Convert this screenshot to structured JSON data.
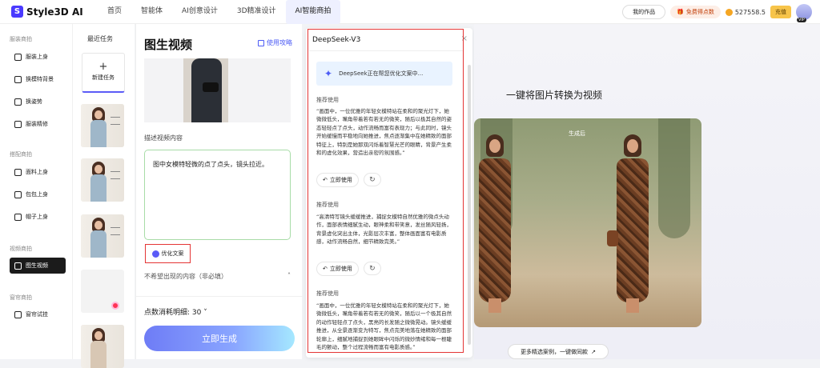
{
  "header": {
    "logo_mark": "S",
    "logo_text": "Style3D AI",
    "nav": [
      "首页",
      "智能体",
      "AI创意设计",
      "3D精准设计",
      "AI智能商拍"
    ],
    "active_nav_index": 4,
    "my_works": "我的作品",
    "free_points": "免费得点数",
    "balance": "527558.5",
    "topup": "充值",
    "vip": "VIP"
  },
  "sidebar": {
    "sections": [
      {
        "title": "服装商拍",
        "items": [
          "服装上身",
          "换模特背景",
          "换姿势",
          "服装精修"
        ]
      },
      {
        "title": "搭配商拍",
        "items": [
          "面料上身",
          "包包上身",
          "帽子上身"
        ]
      },
      {
        "title": "视频商拍",
        "items": [
          "图生视频"
        ]
      },
      {
        "title": "窗帘商拍",
        "items": [
          "窗帘试挂"
        ]
      }
    ],
    "active_item": "图生视频"
  },
  "tasks": {
    "title": "最近任务",
    "new_task": "新建任务"
  },
  "form": {
    "title": "图生视频",
    "guide": "使用攻略",
    "desc_label": "描述视频内容",
    "desc_value": "图中女模特轻微的点了点头，镜头拉近。",
    "optimize": "优化文案",
    "negative_label": "不希望出现的内容（非必填）",
    "cost": "点数消耗明细: 30",
    "generate": "立即生成"
  },
  "panel": {
    "title": "DeepSeek-V3",
    "thinking": "DeepSeek正在帮您优化文案中...",
    "rec_label": "推荐使用",
    "use_label": "立即使用",
    "recommendations": [
      "“画面中，一位优雅的年轻女模特站在柔和的聚光灯下，她微微低头，嘴角带着若有若无的微笑，随后以极其自然的姿态轻轻点了点头，动作流畅而富有表现力；与此同时，镜头开始缓慢而平稳地向她推进，焦点逐渐集中在她精致的面部特征上，特别是她那双闪烁着智慧光芒的眼睛，背景产生柔和的虚化效果，营造出亲密的氛围感。”",
      "“高清特写镜头缓缓推进，捕捉女模特自然优雅的微点头动作，面部表情细腻生动，眼神柔和带笑意，发丝随风轻扬，背景虚化突出主体，光影层次丰富，整体画面富有电影质感，动作流畅自然，细节精致完美。”",
      "“画面中，一位优雅的年轻女模特站在柔和的聚光灯下，她微微低头，嘴角带着若有若无的微笑，随后以一个极其自然的动作轻轻点了点头，黑亮的长发随之微微晃动。镜头缓缓推进，从全景逐渐变为特写，焦点完美地落在她精致的面部轮廓上，细腻地捕捉到她眼眸中闪烁的微妙情绪和每一根睫毛的颤动，整个过程流畅而富有电影质感。”"
    ]
  },
  "showcase": {
    "title": "一键将图片转换为视频",
    "after_label": "生成后",
    "more": "更多精选案例，一键做同款"
  }
}
